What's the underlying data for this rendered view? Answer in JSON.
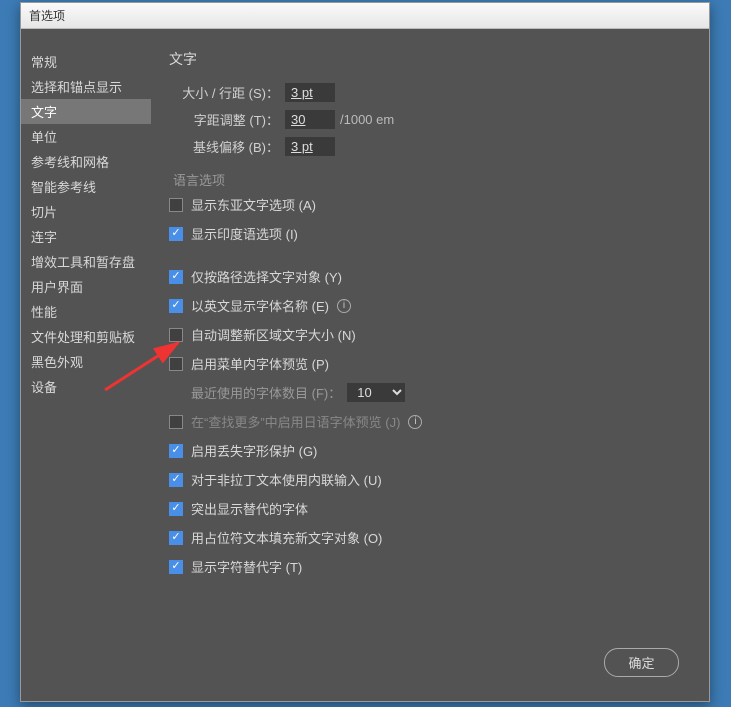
{
  "window_title": "首选项",
  "sidebar": {
    "items": [
      {
        "label": "常规"
      },
      {
        "label": "选择和锚点显示"
      },
      {
        "label": "文字",
        "selected": true
      },
      {
        "label": "单位"
      },
      {
        "label": "参考线和网格"
      },
      {
        "label": "智能参考线"
      },
      {
        "label": "切片"
      },
      {
        "label": "连字"
      },
      {
        "label": "增效工具和暂存盘"
      },
      {
        "label": "用户界面"
      },
      {
        "label": "性能"
      },
      {
        "label": "文件处理和剪贴板"
      },
      {
        "label": "黑色外观"
      },
      {
        "label": "设备"
      }
    ]
  },
  "main": {
    "heading": "文字",
    "size_label": "大小 / 行距 (S)：",
    "size_value": "3 pt",
    "tracking_label": "字距调整 (T)：",
    "tracking_value": "30",
    "tracking_unit": "/1000 em",
    "baseline_label": "基线偏移 (B)：",
    "baseline_value": "3 pt",
    "lang_section": "语言选项",
    "chk_east_asian": "显示东亚文字选项 (A)",
    "chk_indic": "显示印度语选项 (I)",
    "chk_path_only": "仅按路径选择文字对象 (Y)",
    "chk_english_font": "以英文显示字体名称 (E)",
    "chk_auto_size": "自动调整新区域文字大小 (N)",
    "chk_menu_preview": "启用菜单内字体预览 (P)",
    "recent_fonts_label": "最近使用的字体数目 (F)：",
    "recent_fonts_value": "10",
    "chk_jp_find_more": "在“查找更多”中启用日语字体预览 (J)",
    "chk_missing_glyph": "启用丢失字形保护 (G)",
    "chk_inline_input": "对于非拉丁文本使用内联输入 (U)",
    "chk_highlight_sub": "突出显示替代的字体",
    "chk_fill_placeholder": "用占位符文本填充新文字对象 (O)",
    "chk_show_alt": "显示字符替代字 (T)",
    "ok_button": "确定"
  }
}
